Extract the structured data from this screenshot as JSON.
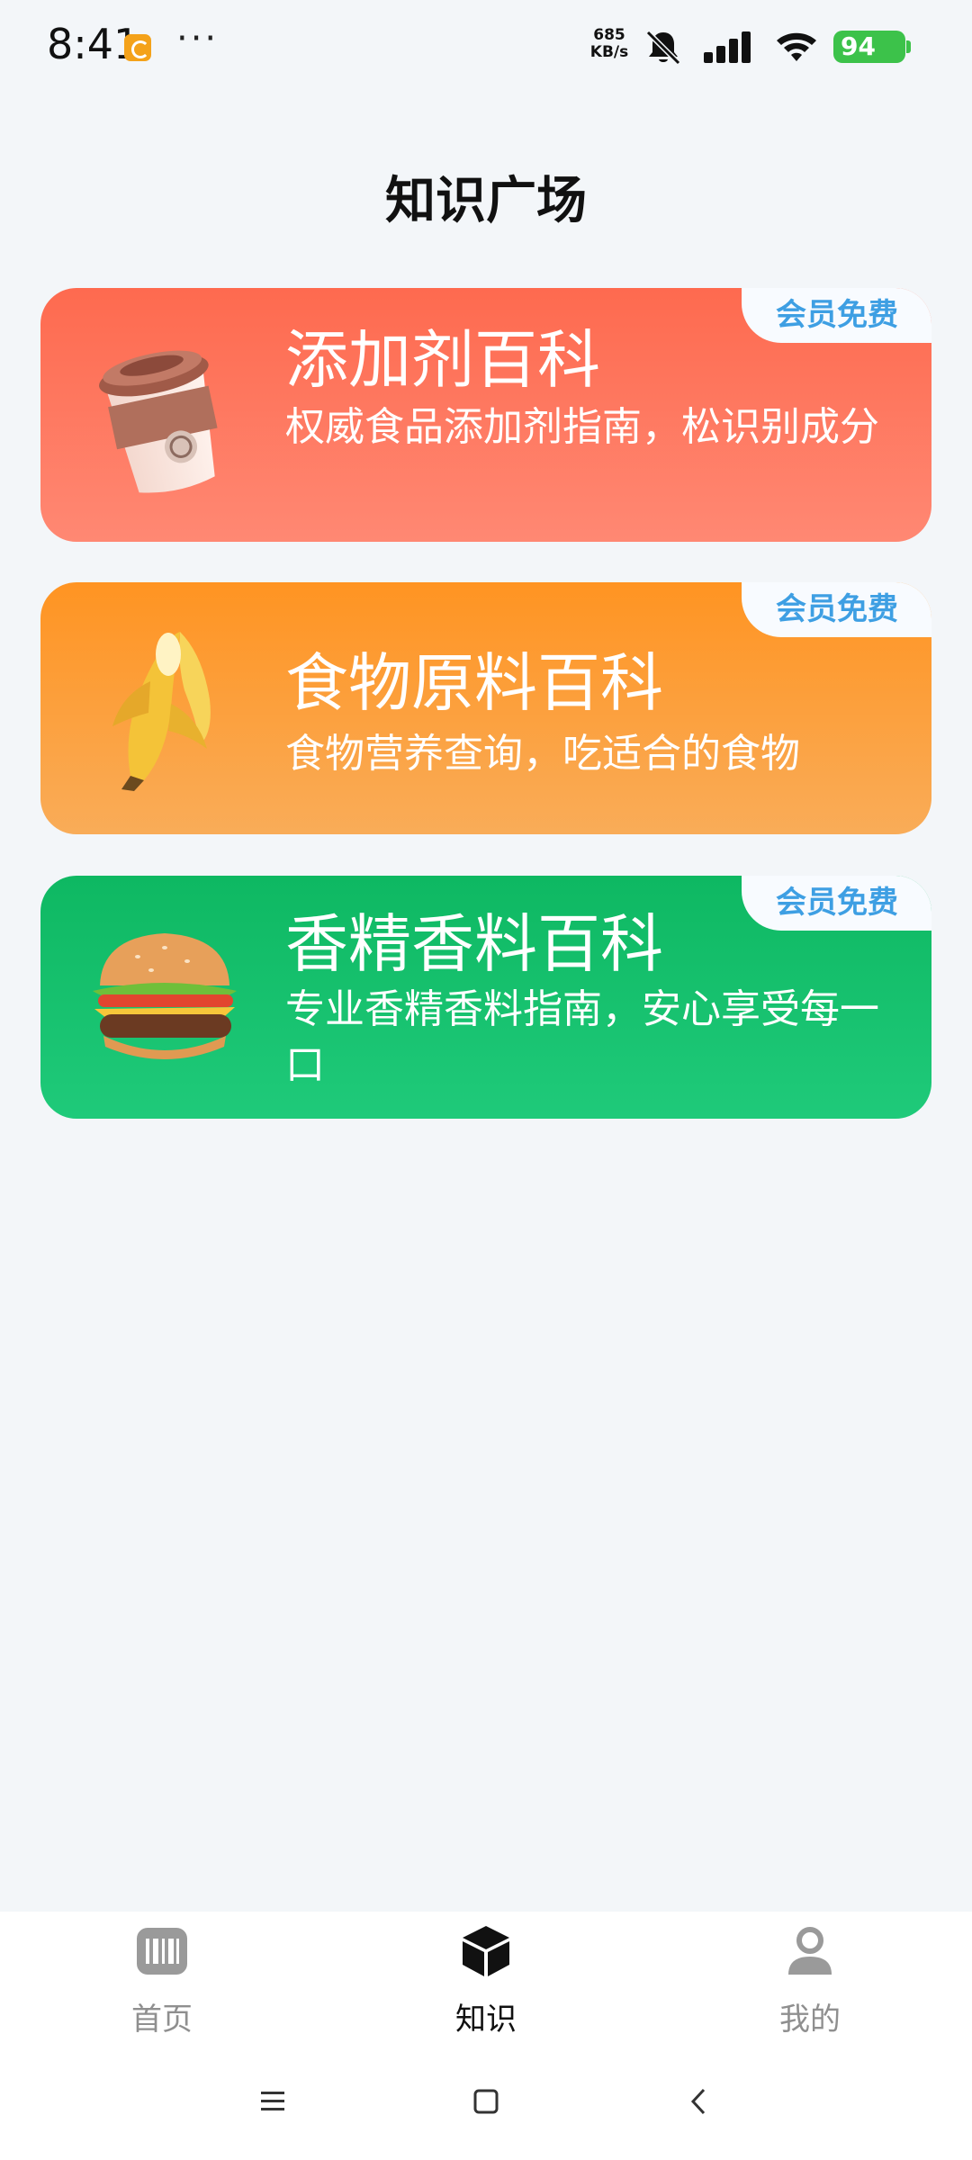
{
  "status_bar": {
    "time": "8:41",
    "more": "···",
    "net_speed_value": "685",
    "net_speed_unit": "KB/s",
    "battery": "94",
    "icons": [
      "app-badge-icon",
      "bell-muted-icon",
      "signal-icon",
      "wifi-icon",
      "battery-icon"
    ]
  },
  "page": {
    "title": "知识广场"
  },
  "cards": [
    {
      "title": "添加剂百科",
      "description": "权威食品添加剂指南，松识别成分",
      "tag": "会员免费",
      "icon": "coffee-cup-icon",
      "color": "#fe6a4f"
    },
    {
      "title": "食物原料百科",
      "description": "食物营养查询，吃适合的食物",
      "tag": "会员免费",
      "icon": "banana-icon",
      "color": "#ff9422"
    },
    {
      "title": "香精香料百科",
      "description": "专业香精香料指南，安心享受每一口",
      "tag": "会员免费",
      "icon": "burger-icon",
      "color": "#0eb862"
    }
  ],
  "tab_bar": {
    "items": [
      {
        "label": "首页",
        "icon": "barcode-icon",
        "active": false
      },
      {
        "label": "知识",
        "icon": "cube-icon",
        "active": true
      },
      {
        "label": "我的",
        "icon": "user-icon",
        "active": false
      }
    ]
  },
  "system_nav": {
    "icons": [
      "menu-icon",
      "home-square-icon",
      "back-icon"
    ]
  }
}
